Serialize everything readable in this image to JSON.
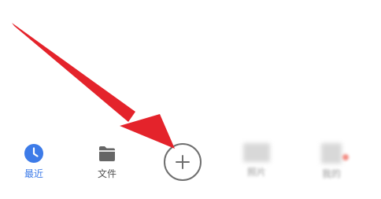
{
  "tabbar": {
    "recent_label": "最近",
    "files_label": "文件",
    "photos_label": "照片",
    "mine_label": "我的"
  },
  "colors": {
    "accent": "#3d7be8",
    "arrow": "#e4232b",
    "file_icon": "#666666"
  },
  "icons": {
    "recent": "clock-icon",
    "files": "folder-icon",
    "add": "plus-icon",
    "annotation": "red-arrow"
  }
}
